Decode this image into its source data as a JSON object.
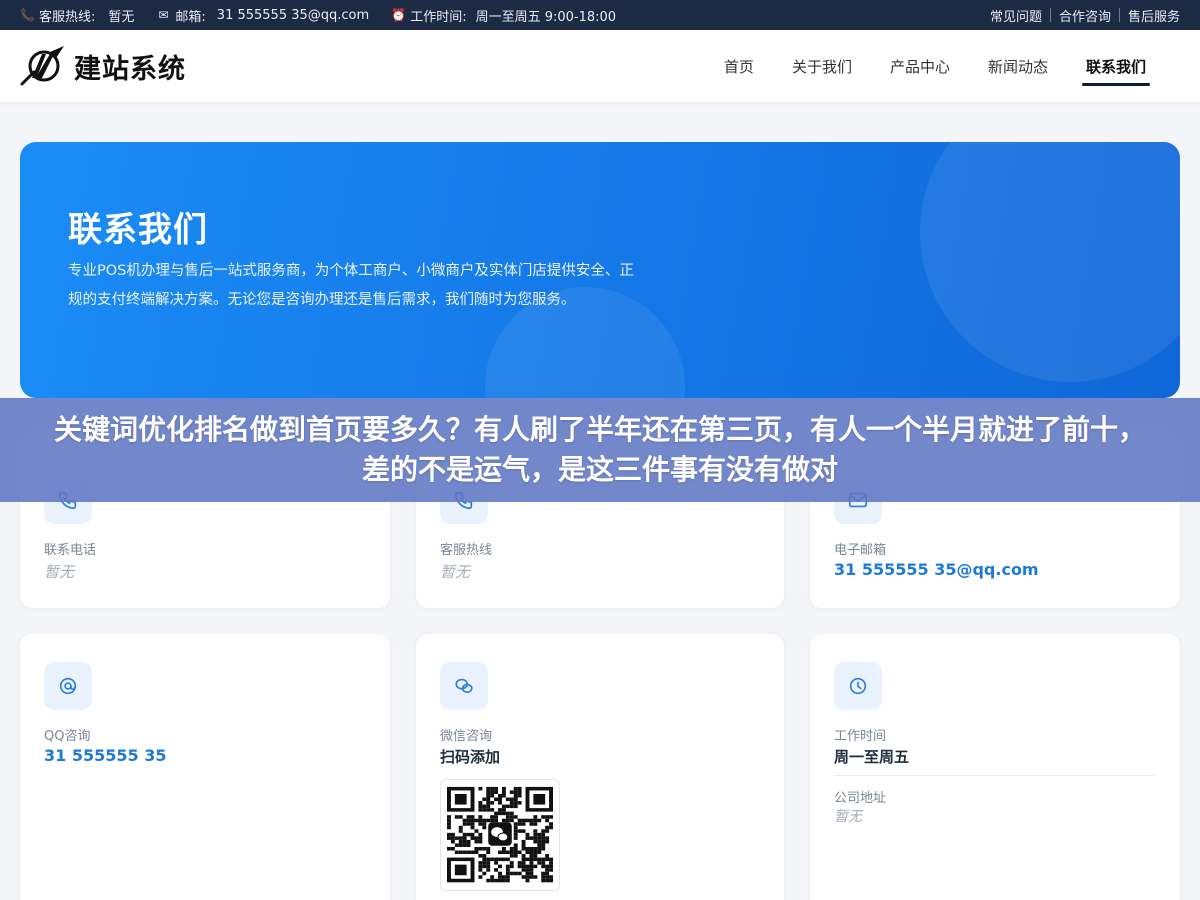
{
  "topbar": {
    "hotline_label": "客服热线:",
    "hotline_value": "暂无",
    "email_label": "邮箱:",
    "email_value": "31 555555 35@qq.com",
    "hours_label": "工作时间:",
    "hours_value": "周一至周五 9:00-18:00",
    "links": [
      "常见问题",
      "合作咨询",
      "售后服务"
    ]
  },
  "header": {
    "brand": "建站系统",
    "nav": [
      "首页",
      "关于我们",
      "产品中心",
      "新闻动态",
      "联系我们"
    ],
    "active_nav": "联系我们"
  },
  "hero": {
    "title": "联系我们",
    "description": "专业POS机办理与售后一站式服务商，为个体工商户、小微商户及实体门店提供安全、正规的支付终端解决方案。无论您是咨询办理还是售后需求，我们随时为您服务。"
  },
  "cards": {
    "phone": {
      "label": "联系电话",
      "value": "暂无"
    },
    "hotline": {
      "label": "客服热线",
      "value": "暂无"
    },
    "email": {
      "label": "电子邮箱",
      "value": "31 555555 35@qq.com"
    },
    "qq": {
      "label": "QQ咨询",
      "value": "31 555555 35"
    },
    "wechat": {
      "label": "微信咨询",
      "value": "扫码添加"
    },
    "hours": {
      "label": "工作时间",
      "value": "周一至周五",
      "address_label": "公司地址",
      "address_value": "暂无"
    }
  },
  "banner": {
    "text": "关键词优化排名做到首页要多久？有人刷了半年还在第三页，有人一个半月就进了前十，差的不是运气，是这三件事有没有做对"
  },
  "colors": {
    "topbar_bg": "#1d2a44",
    "hero_blue": "#1577e7",
    "link_blue": "#1d7ad9",
    "banner_bg": "#6076c4"
  }
}
